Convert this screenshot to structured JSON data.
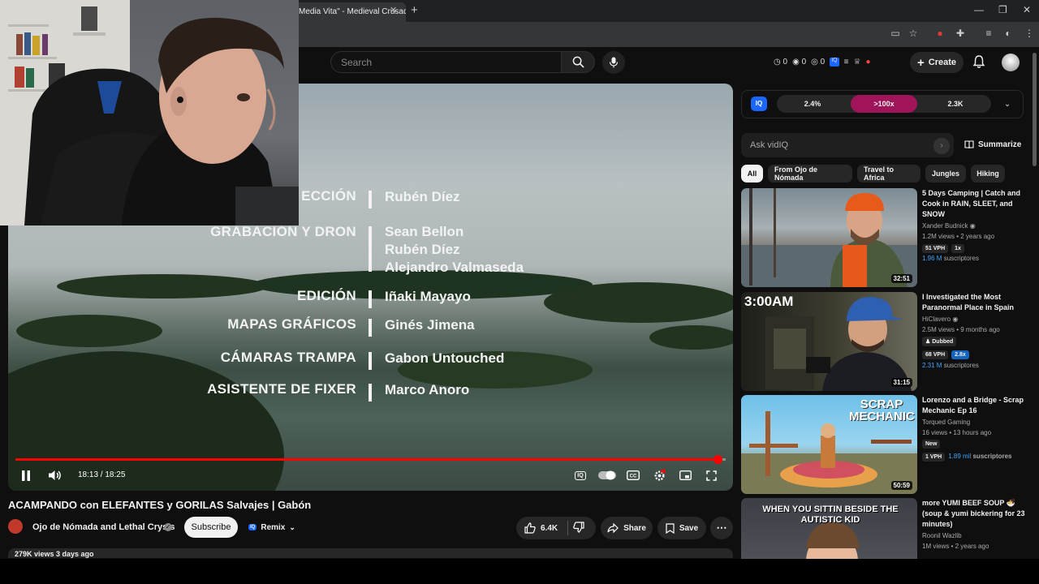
{
  "browser": {
    "tab_title": "Media Vita\" - Medieval Crusad",
    "close_tab_icon": "close-icon",
    "new_tab_icon": "plus-icon"
  },
  "header": {
    "search_placeholder": "Search",
    "stats": [
      "0",
      "0",
      "0"
    ],
    "create_label": "Create"
  },
  "player": {
    "credits": [
      {
        "role": "ECCIÓN",
        "names": [
          "Rubén Díez"
        ]
      },
      {
        "role": "GRABACIÓN Y DRON",
        "names": [
          "Sean Bellon",
          "Rubén Díez",
          "Alejandro Valmaseda"
        ]
      },
      {
        "role": "EDICIÓN",
        "names": [
          "Iñaki Mayayo"
        ]
      },
      {
        "role": "MAPAS GRÁFICOS",
        "names": [
          "Ginés Jimena"
        ]
      },
      {
        "role": "CÁMARAS TRAMPA",
        "names": [
          "Gabon Untouched"
        ]
      },
      {
        "role": "ASISTENTE DE FIXER",
        "names": [
          "Marco Anoro"
        ]
      }
    ],
    "time": "18:13 / 18:25",
    "progress": 0.988
  },
  "video": {
    "title": "ACAMPANDO con ELEFANTES y GORILAS Salvajes | Gabón",
    "channel": "Ojo de Nómada and Lethal Crysis",
    "subscribe_label": "Subscribe",
    "remix_label": "Remix",
    "likes": "6.4K",
    "share_label": "Share",
    "save_label": "Save",
    "views_line": "279K views  3 days ago"
  },
  "vidiq": {
    "logo": "IQ",
    "stats": [
      "2.4%",
      ">100x",
      "2.3K"
    ],
    "ask_placeholder": "Ask vidIQ",
    "summarize_label": "Summarize"
  },
  "chips": [
    "All",
    "From Ojo de Nómada",
    "Travel to Africa",
    "Jungles",
    "Hiking"
  ],
  "recommendations": [
    {
      "title": "5 Days Camping | Catch and Cook in RAIN, SLEET, and SNOW",
      "channel": "Xander Budnick",
      "meta": "1.2M views • 2 years ago",
      "tags": [
        "51 VPH",
        "1x"
      ],
      "subs": "1.96 M",
      "subs_suffix": "suscriptores",
      "duration": "32:51"
    },
    {
      "title": "I Investigated the Most Paranormal Place in Spain",
      "channel": "HiClavero",
      "meta": "2.5M views • 9 months ago",
      "badge": "Dubbed",
      "tags": [
        "68 VPH",
        "2.8x"
      ],
      "subs": "2.31 M",
      "subs_suffix": "suscriptores",
      "duration": "31:15",
      "overlay": "3:00AM"
    },
    {
      "title": "Lorenzo and a Bridge - Scrap Mechanic Ep 16",
      "channel": "Torqued Gaming",
      "meta": "16 views • 13 hours ago",
      "badge": "New",
      "tags": [
        "1 VPH"
      ],
      "subs": "1.89 mil",
      "subs_suffix": "suscriptores",
      "duration": "50:59",
      "overlay": "SCRAP MECHANIC"
    },
    {
      "title": "more YUMI BEEF SOUP 🍜 (soup & yumi bickering for 23 minutes)",
      "channel": "Roonil Wazlib",
      "meta": "1M views • 2 years ago",
      "overlay": "WHEN YOU SITTIN BESIDE THE AUTISTIC KID"
    }
  ]
}
